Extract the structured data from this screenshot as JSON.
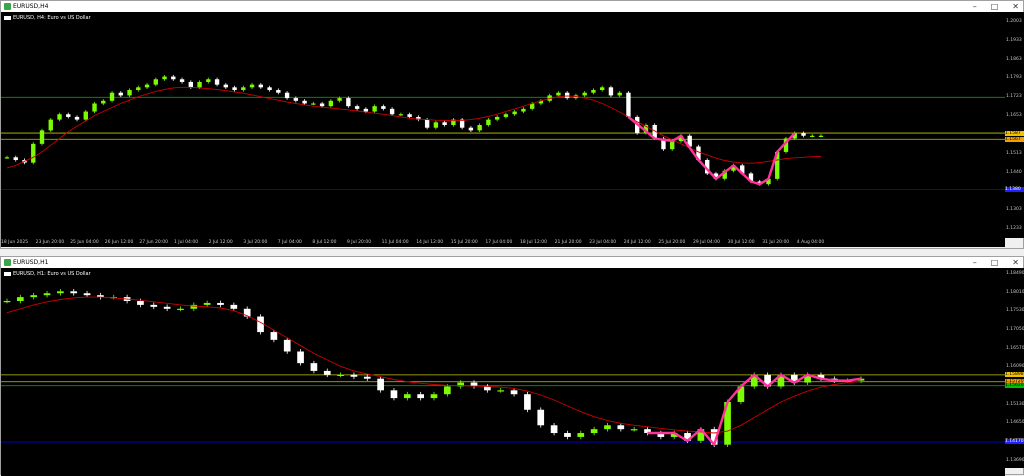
{
  "windows": [
    {
      "title": "EURUSD,H4",
      "chart_label": "EURUSD, H4:  Euro vs US Dollar",
      "y_labels": [
        "1.2003",
        "1.1933",
        "1.1863",
        "1.1793",
        "1.1723",
        "1.1653",
        "1.1583",
        "1.1513",
        "1.1440",
        "1.1373",
        "1.1303",
        "1.1233"
      ],
      "price_tags": [
        {
          "text": "1.1587",
          "color": "#f2c200"
        },
        {
          "text": "1.1567",
          "color": "#f29e00"
        },
        {
          "text": "1.1380",
          "color": "#2020ff"
        }
      ],
      "x_labels": [
        "18 Jun 2025",
        "23 Jun 20:00",
        "25 Jun 04:00",
        "26 Jun 12:00",
        "27 Jun 20:00",
        "1 Jul 04:00",
        "2 Jul 12:00",
        "3 Jul 20:00",
        "7 Jul 04:00",
        "8 Jul 12:00",
        "9 Jul 20:00",
        "11 Jul 04:00",
        "14 Jul 12:00",
        "15 Jul 20:00",
        "17 Jul 04:00",
        "18 Jul 12:00",
        "21 Jul 20:00",
        "23 Jul 04:00",
        "24 Jul 12:00",
        "25 Jul 20:00",
        "29 Jul 04:00",
        "30 Jul 12:00",
        "31 Jul 20:00",
        "4 Aug 04:00"
      ],
      "colors": {
        "up": "#7cfc00",
        "down": "#ffffff",
        "ma": "#cc0000",
        "level_green": "#00a000",
        "level_yellow": "#c8c800",
        "level_blue": "#0000ff",
        "zigzag": "#ff3399"
      }
    },
    {
      "title": "EURUSD,H1",
      "chart_label": "EURUSD, H1:  Euro vs US Dollar",
      "y_labels": [
        "1.18490",
        "1.18010",
        "1.17530",
        "1.17050",
        "1.16570",
        "1.16090",
        "1.15130",
        "1.14650",
        "1.14170",
        "1.13690"
      ],
      "price_tags": [
        {
          "text": "1.15898",
          "color": "#f2c200"
        },
        {
          "text": "1.15720",
          "color": "#f29e00"
        },
        {
          "text": "1.15620",
          "color": "#00c000"
        },
        {
          "text": "1.14170",
          "color": "#2020ff"
        }
      ],
      "colors": {
        "up": "#7cfc00",
        "down": "#ffffff",
        "ma": "#cc0000",
        "level_green": "#00a000",
        "level_yellow": "#c8c800",
        "level_blue": "#0000ff",
        "zigzag": "#ff3399"
      }
    }
  ],
  "chart_data": [
    {
      "type": "candlestick",
      "title": "EURUSD, H4: Euro vs US Dollar",
      "ylim": [
        1.12,
        1.204
      ],
      "close_path": [
        1.15,
        1.149,
        1.148,
        1.155,
        1.16,
        1.164,
        1.166,
        1.165,
        1.164,
        1.167,
        1.17,
        1.171,
        1.174,
        1.173,
        1.175,
        1.176,
        1.177,
        1.179,
        1.18,
        1.179,
        1.178,
        1.176,
        1.178,
        1.179,
        1.177,
        1.176,
        1.175,
        1.176,
        1.177,
        1.176,
        1.175,
        1.174,
        1.172,
        1.171,
        1.17,
        1.17,
        1.169,
        1.171,
        1.172,
        1.169,
        1.168,
        1.167,
        1.169,
        1.168,
        1.166,
        1.166,
        1.165,
        1.164,
        1.161,
        1.163,
        1.162,
        1.164,
        1.161,
        1.16,
        1.162,
        1.164,
        1.165,
        1.166,
        1.167,
        1.168,
        1.17,
        1.171,
        1.173,
        1.174,
        1.172,
        1.173,
        1.174,
        1.175,
        1.176,
        1.173,
        1.174,
        1.165,
        1.159,
        1.162,
        1.157,
        1.153,
        1.156,
        1.158,
        1.154,
        1.149,
        1.144,
        1.142,
        1.145,
        1.147,
        1.144,
        1.141,
        1.14,
        1.142,
        1.152,
        1.157,
        1.159,
        1.158,
        1.158,
        1.158
      ],
      "ma_path": [
        1.146,
        1.147,
        1.1485,
        1.15,
        1.152,
        1.1545,
        1.157,
        1.1595,
        1.1615,
        1.1635,
        1.1655,
        1.167,
        1.1685,
        1.17,
        1.1712,
        1.1725,
        1.1735,
        1.1745,
        1.1752,
        1.1758,
        1.176,
        1.176,
        1.1758,
        1.1755,
        1.1752,
        1.1748,
        1.1743,
        1.1738,
        1.1732,
        1.1725,
        1.1718,
        1.1712,
        1.1705,
        1.17,
        1.1695,
        1.169,
        1.1686,
        1.1683,
        1.168,
        1.1676,
        1.1672,
        1.1668,
        1.1664,
        1.166,
        1.1655,
        1.165,
        1.1645,
        1.1642,
        1.164,
        1.1638,
        1.1637,
        1.1636,
        1.1637,
        1.164,
        1.1645,
        1.1652,
        1.166,
        1.167,
        1.168,
        1.169,
        1.17,
        1.171,
        1.1718,
        1.1725,
        1.1728,
        1.1726,
        1.172,
        1.1712,
        1.17,
        1.1685,
        1.1668,
        1.165,
        1.1632,
        1.1615,
        1.1598,
        1.158,
        1.1565,
        1.155,
        1.1535,
        1.152,
        1.1508,
        1.1497,
        1.1488,
        1.1482,
        1.1479,
        1.1478,
        1.148,
        1.1485,
        1.149,
        1.1495,
        1.1498,
        1.15,
        1.1502,
        1.1503
      ],
      "levels": {
        "green": 1.1723,
        "yellow_top": 1.159,
        "yellow_bottom": 1.1567,
        "blue": 1.138
      }
    },
    {
      "type": "candlestick",
      "title": "EURUSD, H1: Euro vs US Dollar",
      "ylim": [
        1.135,
        1.1865
      ],
      "close_path": [
        1.178,
        1.179,
        1.1795,
        1.18,
        1.1805,
        1.18,
        1.1795,
        1.179,
        1.179,
        1.178,
        1.177,
        1.1765,
        1.176,
        1.176,
        1.177,
        1.1775,
        1.177,
        1.176,
        1.174,
        1.17,
        1.168,
        1.165,
        1.162,
        1.16,
        1.159,
        1.159,
        1.1585,
        1.158,
        1.155,
        1.153,
        1.154,
        1.153,
        1.154,
        1.156,
        1.157,
        1.156,
        1.155,
        1.155,
        1.154,
        1.15,
        1.146,
        1.144,
        1.143,
        1.144,
        1.145,
        1.146,
        1.145,
        1.145,
        1.144,
        1.143,
        1.144,
        1.142,
        1.145,
        1.141,
        1.152,
        1.156,
        1.159,
        1.156,
        1.159,
        1.157,
        1.159,
        1.158,
        1.1575,
        1.1575,
        1.158
      ],
      "ma_path": [
        1.175,
        1.176,
        1.177,
        1.1778,
        1.1784,
        1.1788,
        1.179,
        1.179,
        1.1788,
        1.1785,
        1.1782,
        1.1778,
        1.1774,
        1.177,
        1.1767,
        1.1765,
        1.1762,
        1.1755,
        1.1742,
        1.1725,
        1.1705,
        1.1685,
        1.1665,
        1.1645,
        1.1628,
        1.1612,
        1.16,
        1.1592,
        1.1585,
        1.1578,
        1.1572,
        1.1568,
        1.1565,
        1.1563,
        1.1562,
        1.1561,
        1.156,
        1.1558,
        1.1555,
        1.1548,
        1.1538,
        1.1525,
        1.151,
        1.1495,
        1.1482,
        1.1472,
        1.1465,
        1.146,
        1.1456,
        1.1452,
        1.1448,
        1.1445,
        1.1443,
        1.144,
        1.1445,
        1.146,
        1.148,
        1.15,
        1.152,
        1.1535,
        1.1548,
        1.1558,
        1.1565,
        1.157,
        1.1573
      ],
      "levels": {
        "yellow_top": 1.15898,
        "yellow_bottom": 1.1572,
        "green": 1.1562,
        "blue": 1.1417
      }
    }
  ]
}
